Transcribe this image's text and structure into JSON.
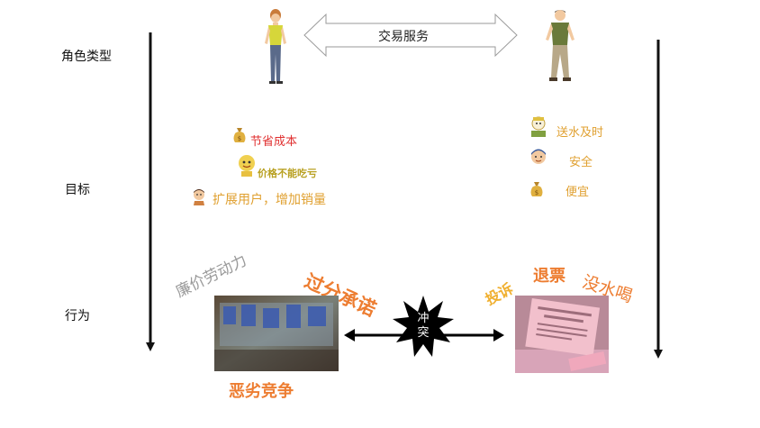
{
  "rows": {
    "role": "角色类型",
    "goal": "目标",
    "behavior": "行为"
  },
  "service_label": "交易服务",
  "left_goals": {
    "save_cost": "节省成本",
    "price_no_loss": "价格不能吃亏",
    "expand_users": "扩展用户，增加销量"
  },
  "right_goals": {
    "timely": "送水及时",
    "safe": "安全",
    "cheap": "便宜"
  },
  "left_behaviors": {
    "cheap_labor": "廉价劳动力",
    "overpromise": "过分承诺",
    "vicious_competition": "恶劣竞争"
  },
  "right_behaviors": {
    "complain": "投诉",
    "refund": "退票",
    "no_water": "没水喝"
  },
  "conflict": {
    "line1": "冲",
    "line2": "突"
  },
  "colors": {
    "orange": "#ed7d31",
    "gold": "#f0b030",
    "red": "#e03030",
    "gray": "#9a9a9a",
    "arrow": "#000000"
  }
}
